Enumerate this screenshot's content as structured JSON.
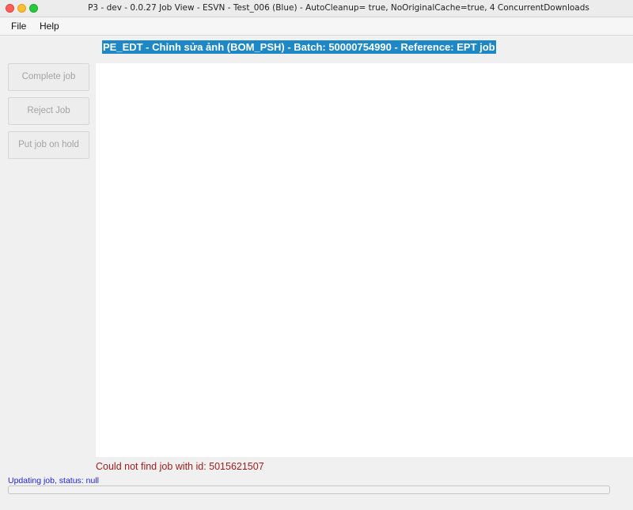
{
  "window": {
    "title": "P3 - dev - 0.0.27 Job View  - ESVN - Test_006 (Blue) - AutoCleanup= true, NoOriginalCache=true, 4 ConcurrentDownloads"
  },
  "menu": {
    "file_label": "File",
    "help_label": "Help"
  },
  "job": {
    "header": "PE_EDT - Chỉnh sửa ảnh (BOM_PSH) - Batch: 50000754990 - Reference: EPT job"
  },
  "actions": {
    "complete_label": "Complete job",
    "reject_label": "Reject Job",
    "hold_label": "Put job on hold"
  },
  "messages": {
    "error": "Could not find job with id: 5015621507",
    "status": "Updating job, status: null"
  },
  "progress": {
    "value": 0
  },
  "colors": {
    "header_bg": "#1e87c6",
    "error_text": "#9b1c1c",
    "status_text": "#1f1fe0"
  }
}
